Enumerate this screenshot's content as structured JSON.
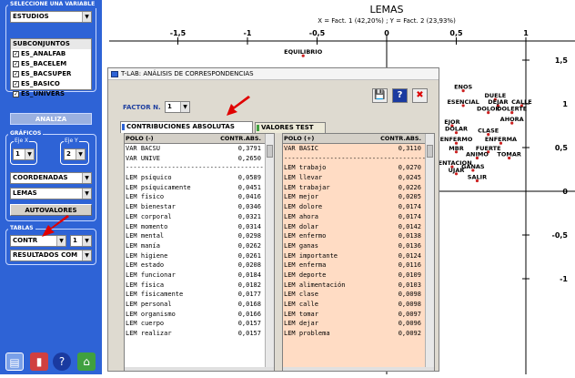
{
  "sidebar": {
    "group_variable": {
      "title": "SELECCIONE UNA VARIABLE",
      "selected": "ESTUDIOS"
    },
    "subsets": {
      "header": "SUBCONJUNTOS",
      "items": [
        {
          "label": "ES_ANALFAB",
          "checked": true
        },
        {
          "label": "ES_BACELEM",
          "checked": true
        },
        {
          "label": "ES_BACSUPER",
          "checked": true
        },
        {
          "label": "ES_BASICO",
          "checked": true
        },
        {
          "label": "ES_UNIVERS",
          "checked": true
        }
      ]
    },
    "analiza_label": "ANALIZA",
    "graficos": {
      "title": "GRÁFICOS",
      "eje_x_label": "Eje X",
      "eje_x_value": "1",
      "eje_y_label": "Eje Y",
      "eje_y_value": "2",
      "coordenadas": "COORDENADAS",
      "lemas": "LEMAS",
      "autovalores_label": "AUTOVALORES"
    },
    "tablas": {
      "title": "TABLAS",
      "contr": "CONTR",
      "factor": "1",
      "resultados": "RESULTADOS COM"
    }
  },
  "chart": {
    "title": "LEMAS",
    "subtitle": "X = Fact. 1 (42,20%) ; Y = Fact. 2 (23,93%)",
    "x_ticks": [
      "-1,5",
      "-1",
      "-0,5",
      "0",
      "0,5",
      "1"
    ],
    "y_ticks": [
      "1,5",
      "1",
      "0,5",
      "0",
      "-0,5",
      "-1"
    ],
    "points": [
      {
        "label": "EQUILIBRIO",
        "x": -0.6,
        "y": 1.55
      },
      {
        "label": "ENOS",
        "x": 0.55,
        "y": 1.15
      },
      {
        "label": "DUELE",
        "x": 0.78,
        "y": 1.05
      },
      {
        "label": "ESENCIAL",
        "x": 0.55,
        "y": 0.98
      },
      {
        "label": "DEJAR",
        "x": 0.8,
        "y": 0.98
      },
      {
        "label": "CALLE",
        "x": 0.97,
        "y": 0.98
      },
      {
        "label": "DOLOR",
        "x": 0.73,
        "y": 0.9
      },
      {
        "label": "DOLERTE",
        "x": 0.9,
        "y": 0.9
      },
      {
        "label": "AHORA",
        "x": 0.9,
        "y": 0.78
      },
      {
        "label": "EJOR",
        "x": 0.47,
        "y": 0.75
      },
      {
        "label": "CLASE",
        "x": 0.73,
        "y": 0.65
      },
      {
        "label": "DOLAR",
        "x": 0.5,
        "y": 0.67
      },
      {
        "label": "ENFERMA",
        "x": 0.82,
        "y": 0.55
      },
      {
        "label": "ENFERMO",
        "x": 0.5,
        "y": 0.55
      },
      {
        "label": "MBR",
        "x": 0.5,
        "y": 0.45
      },
      {
        "label": "FUERTE",
        "x": 0.73,
        "y": 0.45
      },
      {
        "label": "ANIMO",
        "x": 0.65,
        "y": 0.38
      },
      {
        "label": "TOMAR",
        "x": 0.88,
        "y": 0.38
      },
      {
        "label": "MENTACION",
        "x": 0.47,
        "y": 0.28
      },
      {
        "label": "GANAS",
        "x": 0.62,
        "y": 0.24
      },
      {
        "label": "UJAR",
        "x": 0.5,
        "y": 0.2
      },
      {
        "label": "SALIR",
        "x": 0.65,
        "y": 0.12
      }
    ]
  },
  "window": {
    "title": "T-LAB: ANÁLISIS DE CORRESPONDENCIAS",
    "factor_label": "FACTOR N.",
    "factor_value": "1",
    "tab_contrib": "CONTRIBUCIONES ABSOLUTAS",
    "tab_test": "VALORES TEST",
    "left_table": {
      "col_polo": "POLO (-)",
      "col_contr": "CONTR.ABS.",
      "rows": [
        [
          "VAR BACSU",
          "0,3791"
        ],
        [
          "VAR UNIVE",
          "0,2650"
        ],
        [
          "------------------------------------------",
          ""
        ],
        [
          "LEM psíquico",
          "0,0589"
        ],
        [
          "LEM psíquicamente",
          "0,0451"
        ],
        [
          "LEM físico",
          "0,0416"
        ],
        [
          "LEM bienestar",
          "0,0346"
        ],
        [
          "LEM corporal",
          "0,0321"
        ],
        [
          "LEM momento",
          "0,0314"
        ],
        [
          "LEM mental",
          "0,0298"
        ],
        [
          "LEM manía",
          "0,0262"
        ],
        [
          "LEM higiene",
          "0,0261"
        ],
        [
          "LEM estado",
          "0,0208"
        ],
        [
          "LEM funcionar",
          "0,0184"
        ],
        [
          "LEM física",
          "0,0182"
        ],
        [
          "LEM físicamente",
          "0,0177"
        ],
        [
          "LEM personal",
          "0,0168"
        ],
        [
          "LEM organismo",
          "0,0166"
        ],
        [
          "LEM cuerpo",
          "0,0157"
        ],
        [
          "LEM realizar",
          "0,0157"
        ]
      ]
    },
    "right_table": {
      "col_polo": "POLO (+)",
      "col_contr": "CONTR.ABS.",
      "rows": [
        [
          "VAR BASIC",
          "0,3110"
        ],
        [
          "------------------------------------------",
          ""
        ],
        [
          "LEM trabajo",
          "0,0270"
        ],
        [
          "LEM llevar",
          "0,0245"
        ],
        [
          "LEM trabajar",
          "0,0226"
        ],
        [
          "LEM mejor",
          "0,0205"
        ],
        [
          "LEM dolore",
          "0,0174"
        ],
        [
          "LEM ahora",
          "0,0174"
        ],
        [
          "LEM dolar",
          "0,0142"
        ],
        [
          "LEM enfermo",
          "0,0138"
        ],
        [
          "LEM ganas",
          "0,0136"
        ],
        [
          "LEM importante",
          "0,0124"
        ],
        [
          "LEM enferma",
          "0,0116"
        ],
        [
          "LEM deporte",
          "0,0109"
        ],
        [
          "LEM alimentación",
          "0,0103"
        ],
        [
          "LEM clase",
          "0,0098"
        ],
        [
          "LEM calle",
          "0,0098"
        ],
        [
          "LEM tomar",
          "0,0097"
        ],
        [
          "LEM dejar",
          "0,0096"
        ],
        [
          "LEM problema",
          "0,0092"
        ]
      ]
    }
  }
}
